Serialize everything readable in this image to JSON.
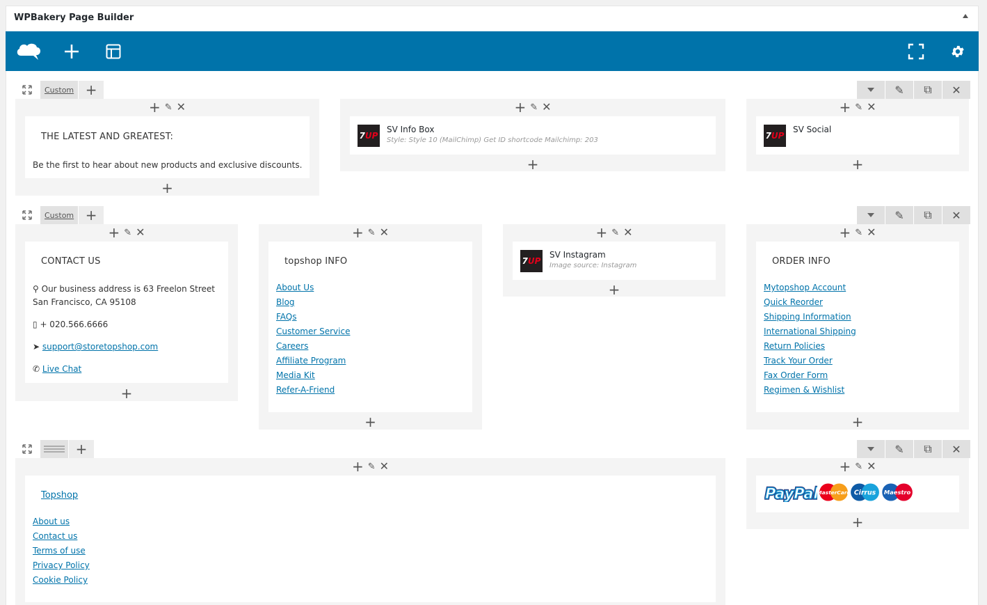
{
  "panel": {
    "title": "WPBakery Page Builder"
  },
  "toolbar": {
    "logo_icon": "wpbakery-logo-icon",
    "add_icon": "plus-icon",
    "template_icon": "template-icon",
    "fullscreen_icon": "fullscreen-icon",
    "settings_icon": "gear-icon",
    "color": "#0073aa"
  },
  "rows": [
    {
      "layout_label": "Custom",
      "columns": [
        {
          "heading": "THE LATEST AND GREATEST:",
          "text": "Be the first to hear about new products and exclusive discounts."
        },
        {
          "title": "SV Info Box",
          "subtitle": "Style: Style 10 (MailChimp)  Get ID shortcode Mailchimp: 203"
        },
        {
          "title": "SV Social"
        }
      ]
    },
    {
      "layout_label": "Custom",
      "columns": [
        {
          "heading": "CONTACT US",
          "address_line1": "Our business address is 63 Freelon Street",
          "address_line2": "San Francisco, CA 95108",
          "phone": "+ 020.566.6666",
          "email": "support@storetopshop.com",
          "chat": "Live Chat"
        },
        {
          "heading": "topshop INFO",
          "links": [
            "About Us",
            "Blog",
            "FAQs",
            "Customer Service",
            "Careers",
            "Affiliate Program",
            "Media Kit",
            "Refer-A-Friend"
          ]
        },
        {
          "title": "SV Instagram",
          "subtitle": "Image source: Instagram"
        },
        {
          "heading": "ORDER INFO",
          "links": [
            "Mytopshop Account",
            "Quick Reorder",
            "Shipping Information",
            "International Shipping",
            "Return Policies",
            "Track Your Order",
            "Fax Order Form",
            "Regimen & Wishlist"
          ]
        }
      ]
    },
    {
      "columns": [
        {
          "heading": "Topshop",
          "links": [
            "About us",
            "Contact us",
            "Terms of use",
            "Privacy Policy",
            "Cookie Policy"
          ]
        },
        {
          "payment": {
            "paypal": "PayPal",
            "mastercard": "MasterCard",
            "cirrus": "Cirrus",
            "maestro": "Maestro"
          }
        }
      ]
    }
  ],
  "logo_text": {
    "seven": "7",
    "up": "UP"
  }
}
